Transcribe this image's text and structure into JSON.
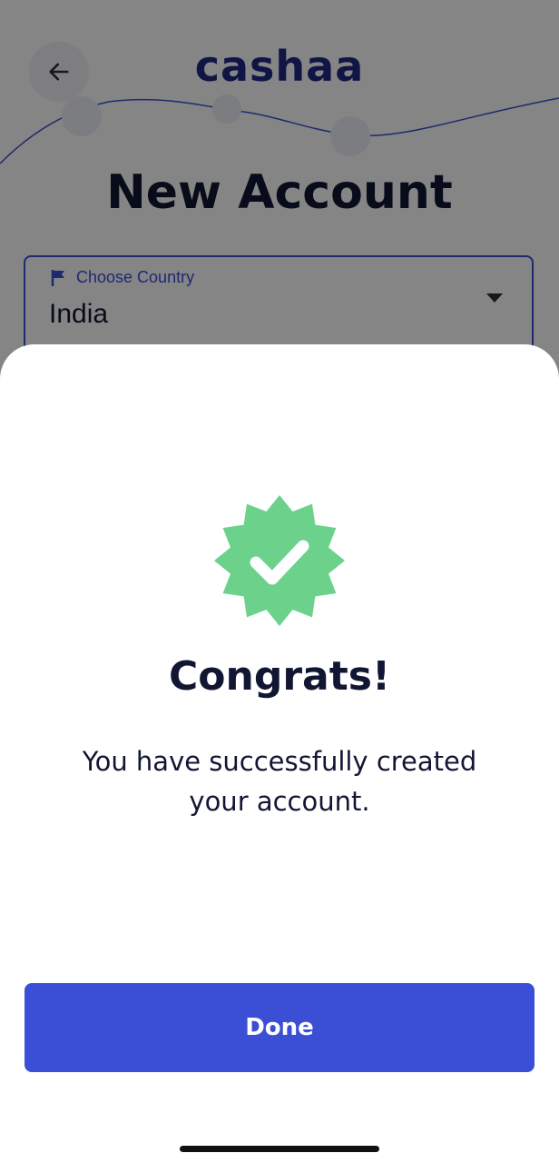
{
  "header": {
    "logo_text": "cashaa",
    "back_icon": "arrow-left-icon"
  },
  "page": {
    "title": "New Account"
  },
  "country_field": {
    "label": "Choose Country",
    "label_icon": "flag-icon",
    "value": "India",
    "dropdown_icon": "caret-down-icon"
  },
  "modal": {
    "badge_icon": "verified-check-badge-icon",
    "title": "Congrats!",
    "message": "You have successfully created your account.",
    "done_label": "Done"
  },
  "colors": {
    "brand": "#1f2a86",
    "accent": "#3b4fd6",
    "success": "#6bd18b",
    "text_dark": "#111633"
  }
}
